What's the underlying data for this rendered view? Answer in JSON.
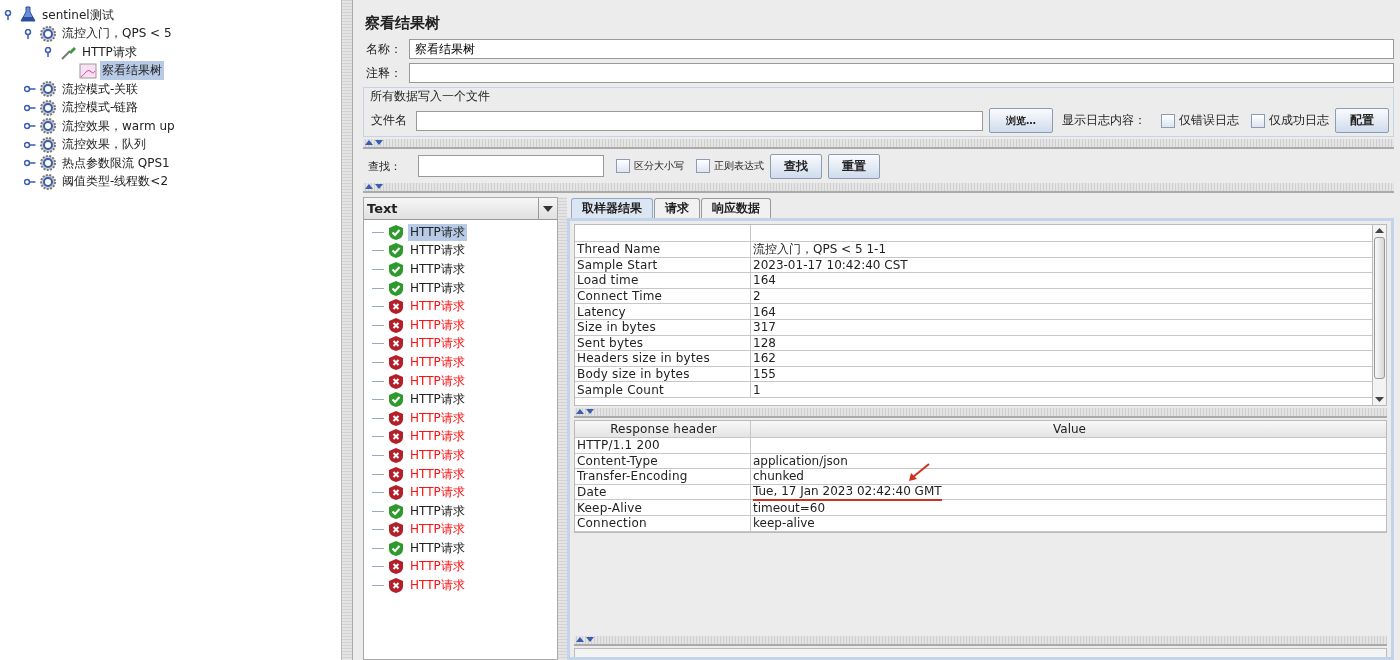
{
  "tree": [
    {
      "label": "sentinel测试",
      "kind": "plan",
      "expanded": true,
      "selected": false,
      "children": [
        {
          "label": "流控入门，QPS < 5",
          "kind": "group",
          "expanded": true,
          "selected": false,
          "children": [
            {
              "label": "HTTP请求",
              "kind": "sampler",
              "expanded": true,
              "selected": false,
              "children": [
                {
                  "label": "察看结果树",
                  "kind": "listener",
                  "selected": true
                }
              ]
            }
          ]
        },
        {
          "label": "流控模式-关联",
          "kind": "group",
          "expanded": false,
          "selected": false
        },
        {
          "label": "流控模式-链路",
          "kind": "group",
          "expanded": false,
          "selected": false
        },
        {
          "label": "流控效果，warm up",
          "kind": "group",
          "expanded": false,
          "selected": false
        },
        {
          "label": "流控效果，队列",
          "kind": "group",
          "expanded": false,
          "selected": false
        },
        {
          "label": "热点参数限流 QPS1",
          "kind": "group",
          "expanded": false,
          "selected": false
        },
        {
          "label": "阈值类型-线程数<2",
          "kind": "group",
          "expanded": false,
          "selected": false
        }
      ]
    }
  ],
  "panel": {
    "title": "察看结果树",
    "name_label": "名称：",
    "name_value": "察看结果树",
    "comment_label": "注释：",
    "file_group": {
      "title": "所有数据写入一个文件",
      "file_label": "文件名",
      "browse_button": "浏览…",
      "log_label": "显示日志内容：",
      "checkboxes": [
        {
          "label": "仅错误日志",
          "checked": false
        },
        {
          "label": "仅成功日志",
          "checked": false
        }
      ],
      "config_button": "配置"
    }
  },
  "search": {
    "label": "查找：",
    "options": [
      {
        "label": "区分大小写",
        "checked": false
      },
      {
        "label": "正则表达式",
        "checked": false
      }
    ],
    "buttons": [
      "查找",
      "重置"
    ]
  },
  "renderer": {
    "value": "Text"
  },
  "results": [
    {
      "label": "HTTP请求",
      "failed": false,
      "selected": true
    },
    {
      "label": "HTTP请求",
      "failed": false,
      "selected": false
    },
    {
      "label": "HTTP请求",
      "failed": false,
      "selected": false
    },
    {
      "label": "HTTP请求",
      "failed": false,
      "selected": false
    },
    {
      "label": "HTTP请求",
      "failed": true,
      "selected": false
    },
    {
      "label": "HTTP请求",
      "failed": true,
      "selected": false
    },
    {
      "label": "HTTP请求",
      "failed": true,
      "selected": false
    },
    {
      "label": "HTTP请求",
      "failed": true,
      "selected": false
    },
    {
      "label": "HTTP请求",
      "failed": true,
      "selected": false
    },
    {
      "label": "HTTP请求",
      "failed": false,
      "selected": false
    },
    {
      "label": "HTTP请求",
      "failed": true,
      "selected": false
    },
    {
      "label": "HTTP请求",
      "failed": true,
      "selected": false
    },
    {
      "label": "HTTP请求",
      "failed": true,
      "selected": false
    },
    {
      "label": "HTTP请求",
      "failed": true,
      "selected": false
    },
    {
      "label": "HTTP请求",
      "failed": true,
      "selected": false
    },
    {
      "label": "HTTP请求",
      "failed": false,
      "selected": false
    },
    {
      "label": "HTTP请求",
      "failed": true,
      "selected": false
    },
    {
      "label": "HTTP请求",
      "failed": false,
      "selected": false
    },
    {
      "label": "HTTP请求",
      "failed": true,
      "selected": false
    },
    {
      "label": "HTTP请求",
      "failed": true,
      "selected": false
    }
  ],
  "tabs": [
    {
      "label": "取样器结果",
      "selected": true
    },
    {
      "label": "请求",
      "selected": false
    },
    {
      "label": "响应数据",
      "selected": false
    }
  ],
  "sampler_table": {
    "rows": [
      [
        "Thread Name",
        "流控入门，QPS < 5 1-1"
      ],
      [
        "Sample Start",
        "2023-01-17 10:42:40 CST"
      ],
      [
        "Load time",
        "164"
      ],
      [
        "Connect Time",
        "2"
      ],
      [
        "Latency",
        "164"
      ],
      [
        "Size in bytes",
        "317"
      ],
      [
        "Sent bytes",
        "128"
      ],
      [
        "Headers size in bytes",
        "162"
      ],
      [
        "Body size in bytes",
        "155"
      ],
      [
        "Sample Count",
        "1"
      ]
    ]
  },
  "response_table": {
    "columns": [
      "Response header",
      "Value"
    ],
    "rows": [
      {
        "cells": [
          "HTTP/1.1 200",
          ""
        ],
        "highlighted": false
      },
      {
        "cells": [
          "Content-Type",
          "application/json"
        ],
        "highlighted": false
      },
      {
        "cells": [
          "Transfer-Encoding",
          "chunked"
        ],
        "highlighted": false
      },
      {
        "cells": [
          "Date",
          "Tue, 17 Jan 2023 02:42:40 GMT"
        ],
        "highlighted": true
      },
      {
        "cells": [
          "Keep-Alive",
          "timeout=60"
        ],
        "highlighted": false
      },
      {
        "cells": [
          "Connection",
          "keep-alive"
        ],
        "highlighted": false
      }
    ]
  }
}
